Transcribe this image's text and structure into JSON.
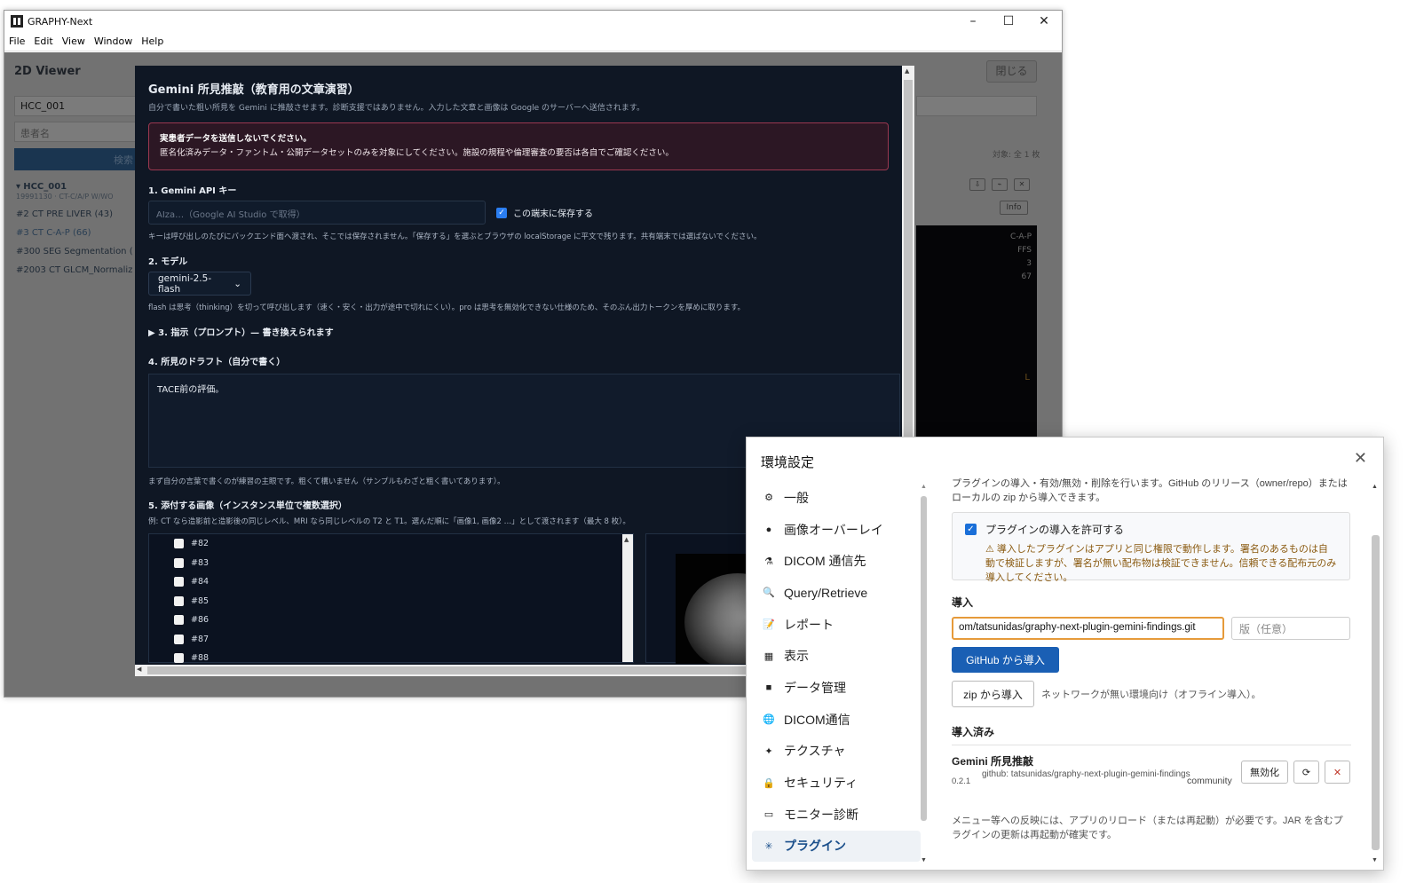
{
  "window": {
    "title": "GRAPHY-Next",
    "controls": {
      "minimize": "–",
      "maximize": "☐",
      "close": "✕"
    },
    "menu": [
      "File",
      "Edit",
      "View",
      "Window",
      "Help"
    ]
  },
  "background": {
    "title": "2D Viewer",
    "close_label": "閉じる",
    "patient_id": "HCC_001",
    "name_placeholder": "患者名",
    "search_label": "検索",
    "tree": {
      "root": "HCC_001",
      "root_sub": "19991130 · CT-C/A/P W/WO",
      "series": [
        "#2 CT PRE LIVER (43)",
        "#3 CT C-A-P (66)",
        "#300 SEG Segmentation (",
        "#2003 CT GLCM_Normaliz"
      ]
    },
    "count_label": "対象: 全 1 枚",
    "info_label": "Info",
    "overlay": [
      "C-A-P",
      "FFS",
      "3",
      "67"
    ],
    "orientation": "L"
  },
  "gemini": {
    "title": "Gemini 所見推敲（教育用の文章演習）",
    "subtitle": "自分で書いた粗い所見を Gemini に推敲させます。診断支援ではありません。入力した文章と画像は Google のサーバーへ送信されます。",
    "warning_title": "実患者データを送信しないでください。",
    "warning_body": "匿名化済みデータ・ファントム・公開データセットのみを対象にしてください。施設の規程や倫理審査の要否は各自でご確認ください。",
    "s1_label": "1. Gemini API キー",
    "api_placeholder": "AIza…（Google AI Studio で取得）",
    "save_label": "この端末に保存する",
    "s1_note": "キーは呼び出しのたびにバックエンド面へ渡され、そこでは保存されません。「保存する」を選ぶとブラウザの localStorage に平文で残ります。共有端末では選ばないでください。",
    "s2_label": "2. モデル",
    "model": "gemini-2.5-flash",
    "s2_note": "flash は思考（thinking）を切って呼び出します（速く・安く・出力が途中で切れにくい）。pro は思考を無効化できない仕様のため、そのぶん出力トークンを厚めに取ります。",
    "s3_label": "▶ 3. 指示（プロンプト）— 書き換えられます",
    "s4_label": "4. 所見のドラフト（自分で書く）",
    "draft": "TACE前の評価。",
    "s4_note": "まず自分の言葉で書くのが練習の主眼です。粗くて構いません（サンプルもわざと粗く書いてあります）。",
    "s5_label": "5. 添付する画像（インスタンス単位で複数選択）",
    "s5_note": "例: CT なら造影前と造影後の同じレベル、MRI なら同じレベルの T2 と T1。選んだ順に「画像1, 画像2 …」として渡されます（最大 8 枚）。",
    "instances": [
      "#82",
      "#83",
      "#84",
      "#85",
      "#86",
      "#87",
      "#88"
    ]
  },
  "prefs": {
    "title": "環境設定",
    "close_icon": "✕",
    "nav": [
      {
        "icon": "⚙",
        "label": "一般"
      },
      {
        "icon": "●",
        "label": "画像オーバーレイ"
      },
      {
        "icon": "⚗",
        "label": "DICOM 通信先"
      },
      {
        "icon": "🔍",
        "label": "Query/Retrieve"
      },
      {
        "icon": "📝",
        "label": "レポート"
      },
      {
        "icon": "▦",
        "label": "表示"
      },
      {
        "icon": "■",
        "label": "データ管理"
      },
      {
        "icon": "🌐",
        "label": "DICOM通信"
      },
      {
        "icon": "✦",
        "label": "テクスチャ"
      },
      {
        "icon": "🔒",
        "label": "セキュリティ"
      },
      {
        "icon": "▭",
        "label": "モニター診断"
      },
      {
        "icon": "✳",
        "label": "プラグイン"
      }
    ],
    "intro_line1": "プラグインの導入・有効/無効・削除を行います。GitHub のリリース（owner/repo）または",
    "intro_line2": "ローカルの zip から導入できます。",
    "allow_label": "プラグインの導入を許可する",
    "allow_warning": "⚠ 導入したプラグインはアプリと同じ権限で動作します。署名のあるものは自動で検証しますが、署名が無い配布物は検証できません。信頼できる配布元のみ導入してください。",
    "install_heading": "導入",
    "url_value": "om/tatsunidas/graphy-next-plugin-gemini-findings.git",
    "version_placeholder": "版（任意）",
    "github_button": "GitHub から導入",
    "zip_button": "zip から導入",
    "zip_note": "ネットワークが無い環境向け（オフライン導入）。",
    "installed_heading": "導入済み",
    "plugin": {
      "name": "Gemini 所見推敲",
      "version": "0.2.1",
      "source": "github: tatsunidas/graphy-next-plugin-gemini-findings",
      "tag": "community",
      "disable_label": "無効化",
      "reload_icon": "⟳",
      "remove_icon": "✕"
    },
    "footer_note": "メニュー等への反映には、アプリのリロード（または再起動）が必要です。JAR を含むプラグインの更新は再起動が確実です。"
  }
}
